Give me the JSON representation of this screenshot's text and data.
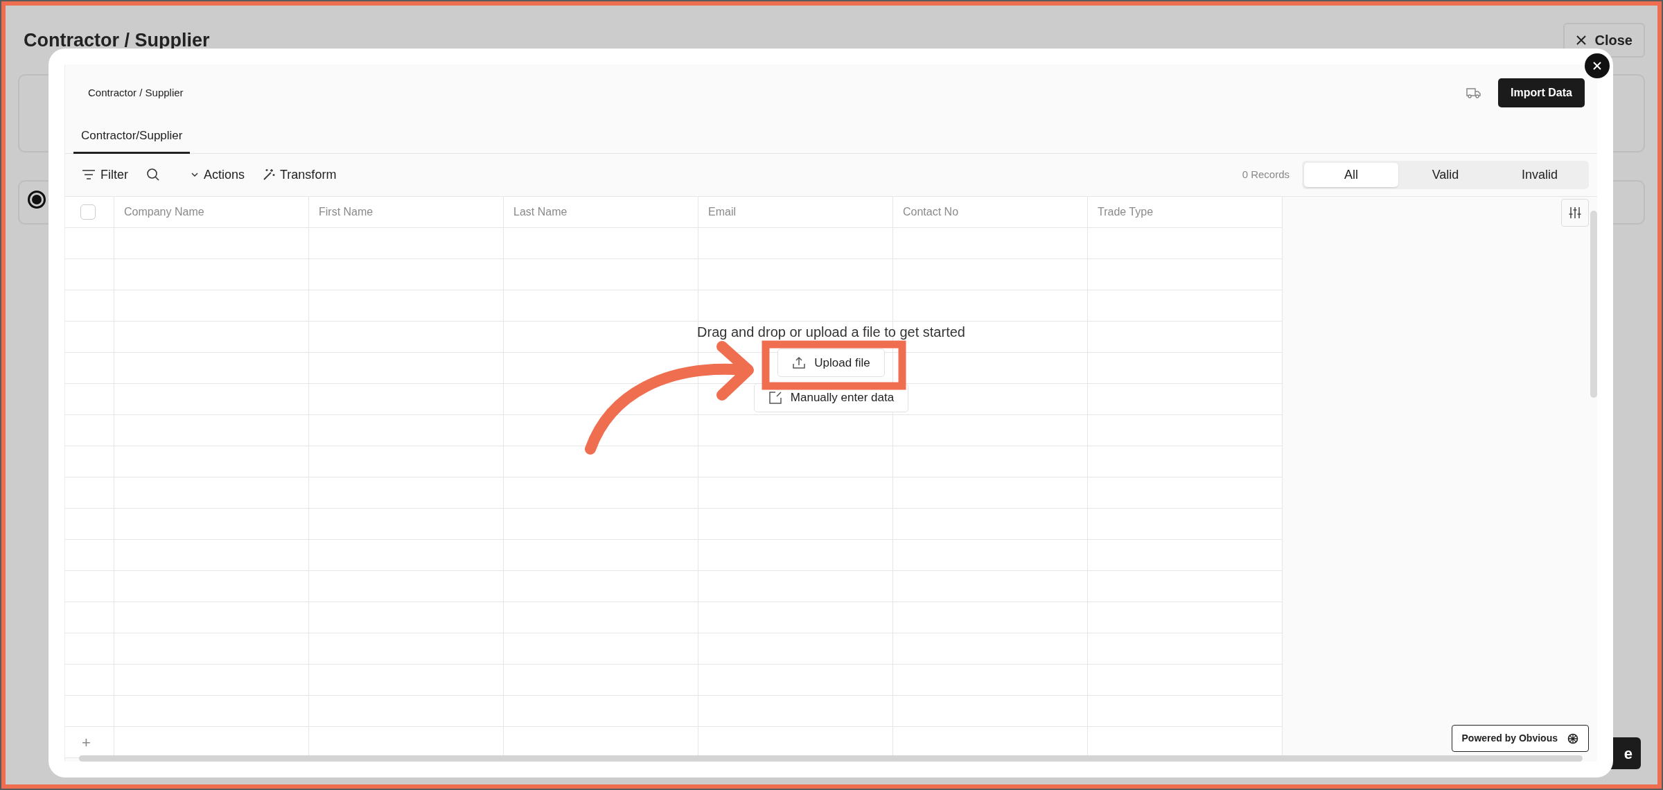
{
  "background_page": {
    "title": "Contractor / Supplier",
    "close_button": "Close",
    "partial_button": "e",
    "radio_checked": true
  },
  "importer": {
    "title": "Contractor / Supplier",
    "import_button": "Import Data",
    "tabs": [
      {
        "label": "Contractor/Supplier",
        "selected": true
      }
    ],
    "toolbar": {
      "filter": "Filter",
      "actions": "Actions",
      "transform": "Transform"
    },
    "records": "0 Records",
    "filters": [
      {
        "label": "All",
        "selected": true
      },
      {
        "label": "Valid",
        "selected": false
      },
      {
        "label": "Invalid",
        "selected": false
      }
    ],
    "table": {
      "select_all_checked": false,
      "columns": [
        "Company Name",
        "First Name",
        "Last Name",
        "Email",
        "Contact No",
        "Trade Type"
      ],
      "add_row": "+"
    },
    "empty_state": {
      "message": "Drag and drop or upload a file to get started",
      "upload_button": "Upload file",
      "manual_button": "Manually enter data"
    },
    "powered_by": "Powered by Obvious"
  }
}
